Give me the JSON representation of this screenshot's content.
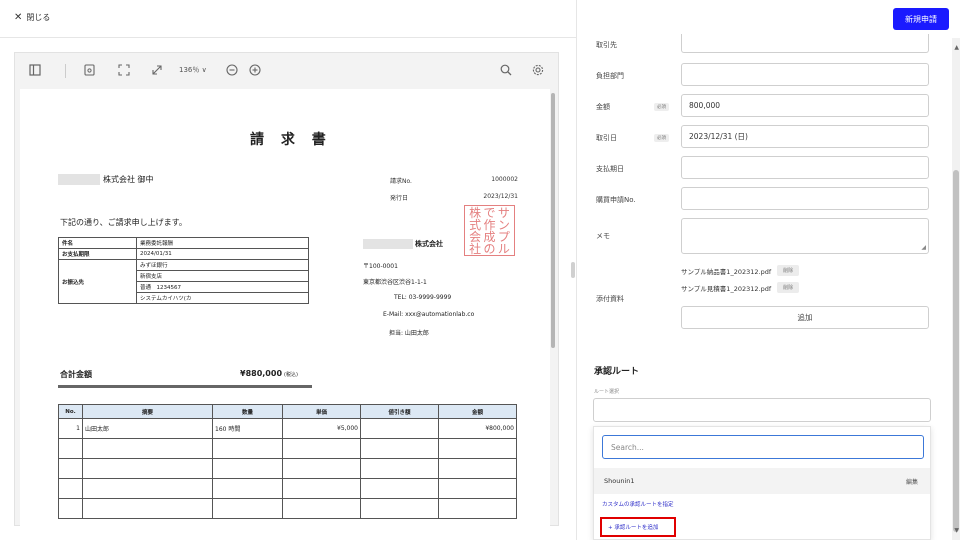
{
  "header": {
    "close_label": "閉じる",
    "new_button": "新規申請"
  },
  "viewer": {
    "zoom": "136％ ∨"
  },
  "invoice": {
    "title": "請 求 書",
    "to": "株式会社 御中",
    "meta": [
      {
        "label": "請求No.",
        "value": "1000002"
      },
      {
        "label": "発行日",
        "value": "2023/12/31"
      }
    ],
    "intro": "下記の通り、ご請求申し上げます。",
    "info_rows": [
      {
        "label": "件名",
        "value": "業務委託報酬"
      },
      {
        "label": "お支払期限",
        "value": "2024/01/31"
      },
      {
        "label": "お振込先",
        "values": [
          "みずほ銀行",
          "新宿支店",
          "普通　1234567",
          "システムカイハツ(カ"
        ]
      }
    ],
    "seller": {
      "name": "株式会社",
      "postal": "〒100-0001",
      "address": "東京都渋谷区渋谷1-1-1",
      "tel": "TEL:  03-9999-9999",
      "email": "E-Mail:  xxx@automationlab.co",
      "person": "担当:  山田太郎"
    },
    "stamp_chars": [
      "株",
      "で",
      "サ",
      "式",
      "作",
      "ン",
      "会",
      "成",
      "プ",
      "社",
      "の",
      "ル"
    ],
    "total_label": "合計金額",
    "total_value": "¥880,000",
    "total_tax": "(税込)",
    "columns": [
      "No.",
      "摘要",
      "数量",
      "単価",
      "値引き額",
      "金額"
    ],
    "rows": [
      {
        "no": "1",
        "desc": "山田太郎",
        "qty": "160 時間",
        "unit": "¥5,000",
        "discount": "",
        "amount": "¥800,000"
      }
    ]
  },
  "form": {
    "labels": {
      "partner": "取引先",
      "dept": "負担部門",
      "amount": "金額",
      "date": "取引日",
      "due": "支払期日",
      "purchase": "購買申請No.",
      "memo": "メモ",
      "attachment": "添付資料"
    },
    "required": "必須",
    "values": {
      "amount": "800,000",
      "date": "2023/12/31 (日)"
    },
    "attachments": [
      {
        "name": "サンプル納品書1_202312.pdf",
        "delete": "削除"
      },
      {
        "name": "サンプル見積書1_202312.pdf",
        "delete": "削除"
      }
    ],
    "add_label": "追加"
  },
  "approval": {
    "title": "承認ルート",
    "route_label": "ルート選択",
    "search_placeholder": "Search...",
    "option": "Shounin1",
    "option_edit": "編集",
    "custom_link": "カスタムの承認ルートを指定",
    "add_route": "+ 承認ルートを追加"
  }
}
